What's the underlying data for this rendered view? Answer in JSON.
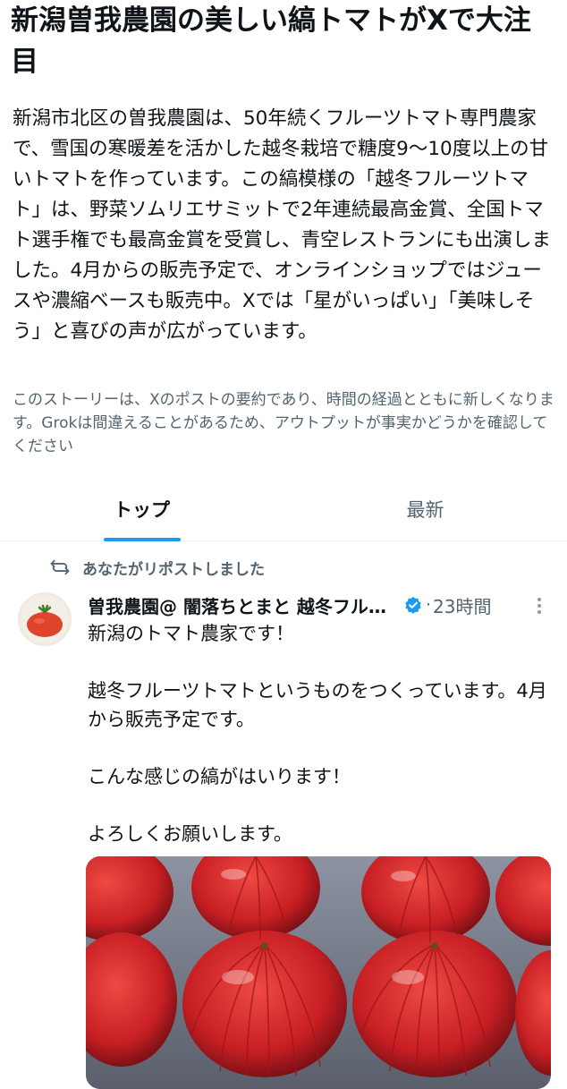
{
  "story": {
    "headline": "新潟曽我農園の美しい縞トマトがXで大注目",
    "summary": "新潟市北区の曽我農園は、50年続くフルーツトマト専門農家で、雪国の寒暖差を活かした越冬栽培で糖度9〜10度以上の甘いトマトを作っています。この縞模様の「越冬フルーツトマト」は、野菜ソムリエサミットで2年連続最高金賞、全国トマト選手権でも最高金賞を受賞し、青空レストランにも出演しました。4月からの販売予定で、オンラインショップではジュースや濃縮ベースも販売中。Xでは「星がいっぱい」「美味しそう」と喜びの声が広がっています。",
    "disclaimer": "このストーリーは、Xのポストの要約であり、時間の経過とともに新しくなります。Grokは間違えることがあるため、アウトプットが事実かどうかを確認してください"
  },
  "tabs": [
    {
      "label": "トップ",
      "active": true
    },
    {
      "label": "最新",
      "active": false
    }
  ],
  "post": {
    "repost_label": "あなたがリポストしました",
    "author": "曽我農園@ 闇落ちとまと 越冬フルーツトマト",
    "time": "23時間",
    "dot": "·",
    "paragraphs": [
      "新潟のトマト農家です！",
      "越冬フルーツトマトというものをつくっています。4月から販売予定です。",
      "こんな感じの縞がはいります！",
      "よろしくお願いします。"
    ]
  },
  "colors": {
    "accent": "#1d9bf0",
    "secondary_text": "#536471",
    "tomato": "#d92b2a"
  },
  "icons": [
    "repost-icon",
    "verified-badge-icon",
    "more-options-icon"
  ]
}
